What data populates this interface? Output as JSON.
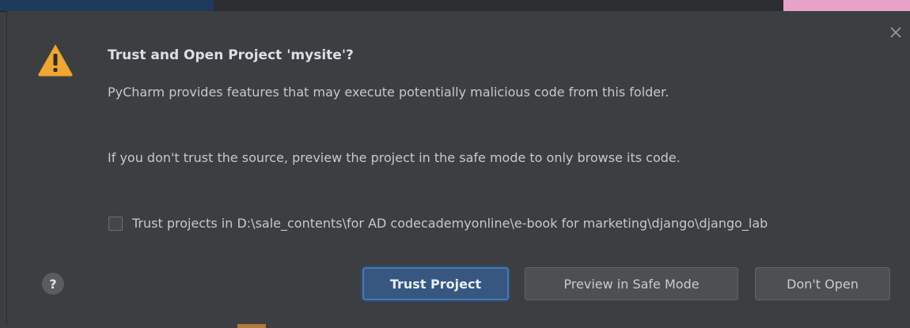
{
  "dialog": {
    "title": "Trust and Open Project 'mysite'?",
    "paragraph1": "PyCharm provides features that may execute potentially malicious code from this folder.",
    "paragraph2": "If you don't trust the source, preview the project in the safe mode to only browse its code.",
    "trust_checkbox_label": "Trust projects in D:\\sale_contents\\for AD codecademyonline\\e-book for marketing\\django\\django_lab",
    "trust_checkbox_checked": false,
    "help_label": "?",
    "close_icon": "close-icon",
    "warning_icon": "warning-icon",
    "buttons": {
      "trust": "Trust Project",
      "safe_mode": "Preview in Safe Mode",
      "dont_open": "Don't Open"
    }
  },
  "colors": {
    "background": "#3c3f41",
    "primary_button": "#365880",
    "warning": "#f0a732"
  }
}
